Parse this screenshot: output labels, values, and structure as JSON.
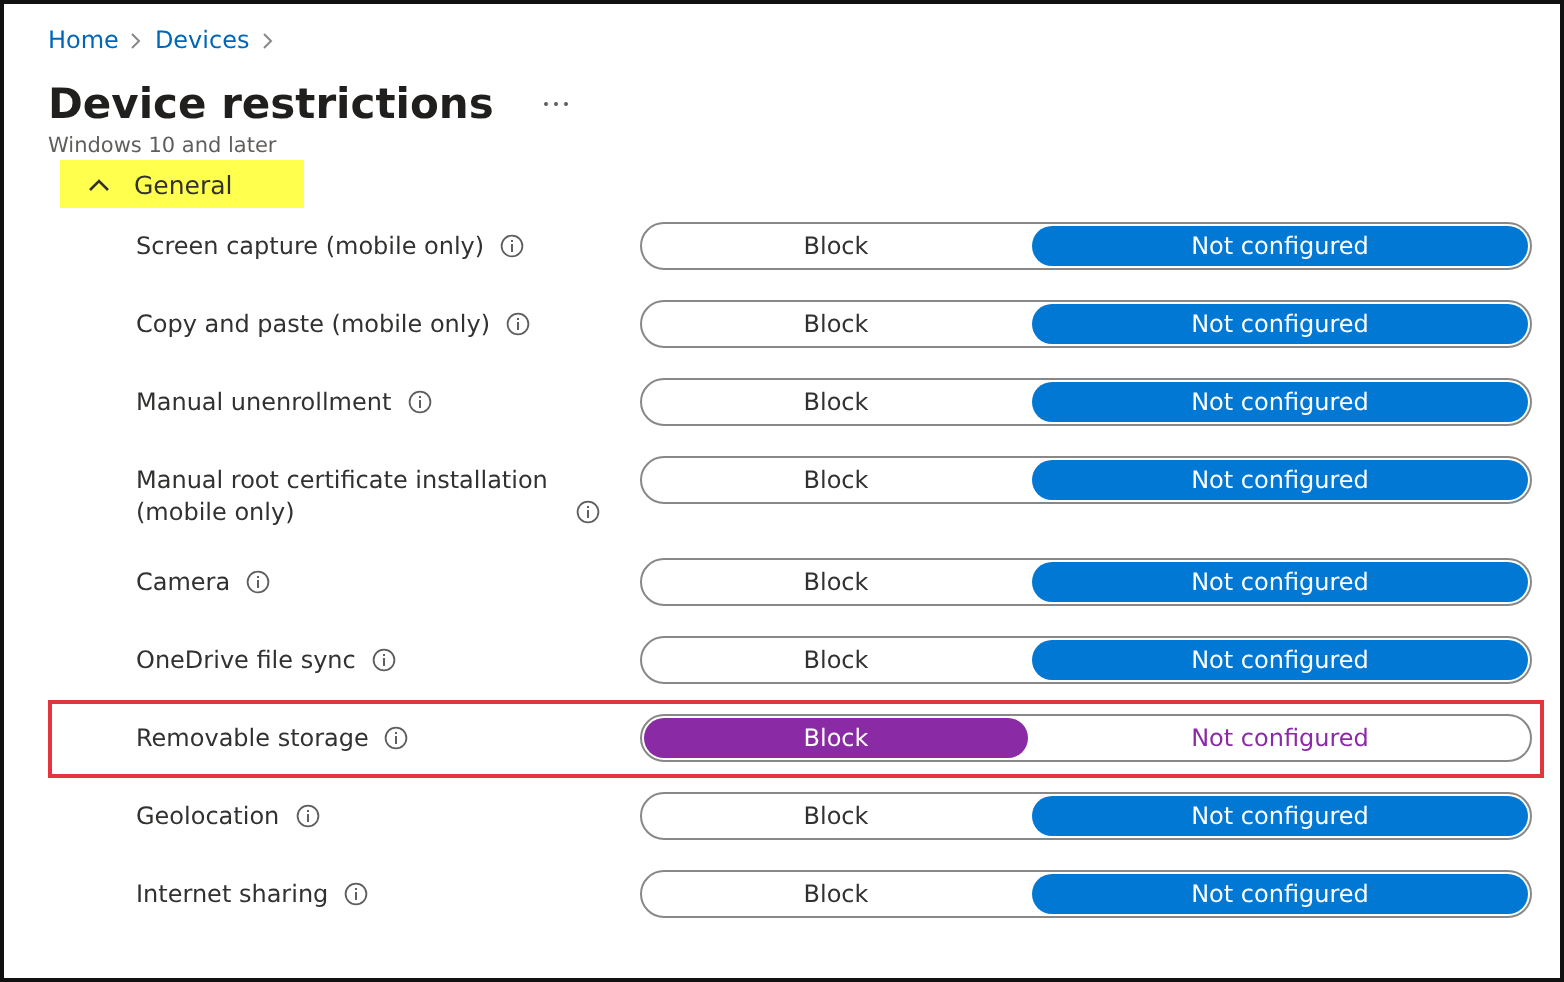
{
  "breadcrumb": [
    "Home",
    "Devices"
  ],
  "title": "Device restrictions",
  "subtitle": "Windows 10 and later",
  "section": {
    "label": "General",
    "expanded": true,
    "highlighted": true
  },
  "rows": [
    {
      "label": "Screen capture (mobile only)",
      "highlighted": false,
      "color": "#0078d4",
      "options": [
        {
          "label": "Block",
          "selected": false
        },
        {
          "label": "Not configured",
          "selected": true
        }
      ]
    },
    {
      "label": "Copy and paste (mobile only)",
      "highlighted": false,
      "color": "#0078d4",
      "options": [
        {
          "label": "Block",
          "selected": false
        },
        {
          "label": "Not configured",
          "selected": true
        }
      ]
    },
    {
      "label": "Manual unenrollment",
      "highlighted": false,
      "color": "#0078d4",
      "options": [
        {
          "label": "Block",
          "selected": false
        },
        {
          "label": "Not configured",
          "selected": true
        }
      ]
    },
    {
      "label": "Manual root certificate installation (mobile only)",
      "highlighted": false,
      "color": "#0078d4",
      "options": [
        {
          "label": "Block",
          "selected": false
        },
        {
          "label": "Not configured",
          "selected": true
        }
      ]
    },
    {
      "label": "Camera",
      "highlighted": false,
      "color": "#0078d4",
      "options": [
        {
          "label": "Block",
          "selected": false
        },
        {
          "label": "Not configured",
          "selected": true
        }
      ]
    },
    {
      "label": "OneDrive file sync",
      "highlighted": false,
      "color": "#0078d4",
      "options": [
        {
          "label": "Block",
          "selected": false
        },
        {
          "label": "Not configured",
          "selected": true
        }
      ]
    },
    {
      "label": "Removable storage",
      "highlighted": true,
      "color": "#8a2aa5",
      "options": [
        {
          "label": "Block",
          "selected": true
        },
        {
          "label": "Not configured",
          "selected": false
        }
      ]
    },
    {
      "label": "Geolocation",
      "highlighted": false,
      "color": "#0078d4",
      "options": [
        {
          "label": "Block",
          "selected": false
        },
        {
          "label": "Not configured",
          "selected": true
        }
      ]
    },
    {
      "label": "Internet sharing",
      "highlighted": false,
      "color": "#0078d4",
      "options": [
        {
          "label": "Block",
          "selected": false
        },
        {
          "label": "Not configured",
          "selected": true
        }
      ]
    }
  ]
}
